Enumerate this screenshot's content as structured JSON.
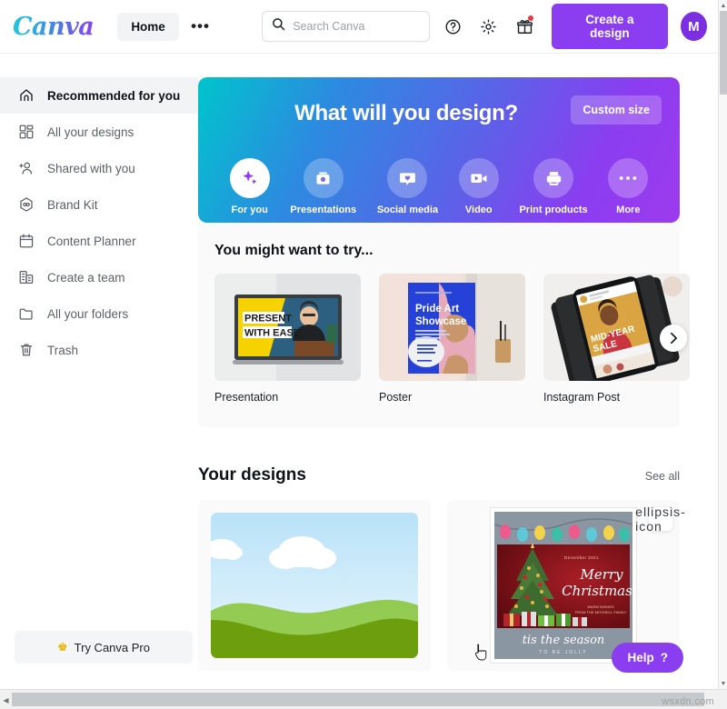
{
  "topbar": {
    "logo_text": "Canva",
    "home_label": "Home",
    "more_label": "•••",
    "search_placeholder": "Search Canva",
    "search_value": "",
    "help_icon": "question-circle-icon",
    "settings_icon": "gear-icon",
    "gift_icon": "gift-icon",
    "create_label": "Create a design",
    "avatar_initial": "M"
  },
  "sidebar": {
    "items": [
      {
        "label": "Recommended for you",
        "icon": "home-icon",
        "active": true
      },
      {
        "label": "All your designs",
        "icon": "grid-icon",
        "active": false
      },
      {
        "label": "Shared with you",
        "icon": "add-person-icon",
        "active": false
      },
      {
        "label": "Brand Kit",
        "icon": "brand-hexagon-icon",
        "active": false
      },
      {
        "label": "Content Planner",
        "icon": "calendar-icon",
        "active": false
      },
      {
        "label": "Create a team",
        "icon": "building-icon",
        "active": false
      },
      {
        "label": "All your folders",
        "icon": "folder-icon",
        "active": false
      },
      {
        "label": "Trash",
        "icon": "trash-icon",
        "active": false
      }
    ],
    "try_pro_label": "Try Canva Pro",
    "crown_icon": "crown-icon"
  },
  "hero": {
    "title": "What will you design?",
    "custom_size_label": "Custom size",
    "gradient_from": "#00C4CC",
    "gradient_to": "#9D3BEE",
    "categories": [
      {
        "label": "For you",
        "icon": "sparkle-icon"
      },
      {
        "label": "Presentations",
        "icon": "presentation-icon"
      },
      {
        "label": "Social media",
        "icon": "heart-speech-bubble-icon"
      },
      {
        "label": "Video",
        "icon": "video-camera-icon"
      },
      {
        "label": "Print products",
        "icon": "printer-icon"
      },
      {
        "label": "More",
        "icon": "ellipsis-icon"
      }
    ]
  },
  "try_section": {
    "title": "You might want to try...",
    "next_icon": "chevron-right-icon",
    "cards": [
      {
        "label": "Presentation",
        "thumb_text_line1": "PRESENT",
        "thumb_text_line2": "WITH EASE"
      },
      {
        "label": "Poster",
        "thumb_text_line1": "Pride Art",
        "thumb_text_line2": "Showcase"
      },
      {
        "label": "Instagram Post",
        "thumb_text_line1": "MID-YEAR",
        "thumb_text_line2": "SALE"
      }
    ]
  },
  "designs_section": {
    "title": "Your designs",
    "see_all_label": "See all",
    "more_icon": "ellipsis-icon",
    "cards": [
      {
        "name": "landscape-design",
        "type": "landscape"
      },
      {
        "name": "christmas-card-design",
        "type": "christmas",
        "date_text": "December 2021",
        "greeting_line1": "Merry",
        "greeting_line2": "Christmas!",
        "sub_text": "WARM WISHES FROM THE MITCHELL FAMILY",
        "footer_line1": "tis the season",
        "footer_line2": "TO BE JOLLY"
      }
    ]
  },
  "help": {
    "label": "Help",
    "mark": "?",
    "color": "#8B3DF0"
  },
  "watermark": {
    "text": "wsxdn.com"
  },
  "accent": {
    "purple": "#8B3DF0",
    "teal": "#00C4CC"
  }
}
